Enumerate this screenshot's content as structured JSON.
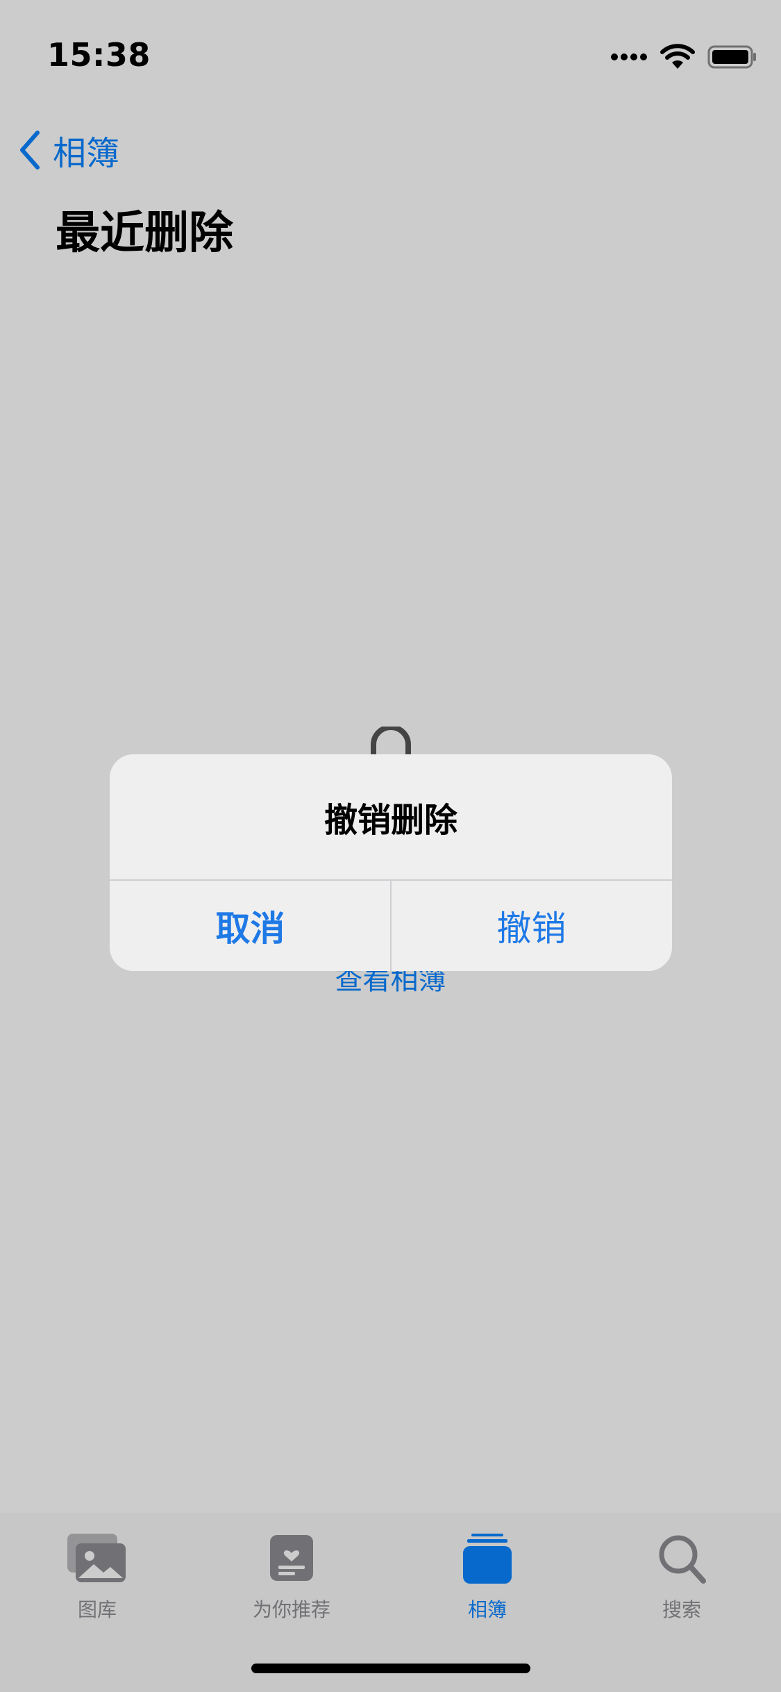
{
  "status_bar": {
    "time": "15:38",
    "icons": [
      "cellular-signal-icon",
      "wifi-icon",
      "battery-icon"
    ]
  },
  "nav": {
    "back_label": "相簿",
    "title": "最近删除"
  },
  "empty_state": {
    "link_label": "查看相簿",
    "icon": "lock-icon"
  },
  "dialog": {
    "title": "撤销删除",
    "cancel_label": "取消",
    "confirm_label": "撤销"
  },
  "tab_bar": {
    "tabs": [
      {
        "label": "图库",
        "icon": "photos-library-icon"
      },
      {
        "label": "为你推荐",
        "icon": "for-you-icon"
      },
      {
        "label": "相簿",
        "icon": "albums-icon",
        "active": true
      },
      {
        "label": "搜索",
        "icon": "search-icon"
      }
    ]
  },
  "colors": {
    "accent": "#0a84ff",
    "dialog_button": "#1e79e6",
    "inactive_tab": "#8e8e93"
  }
}
